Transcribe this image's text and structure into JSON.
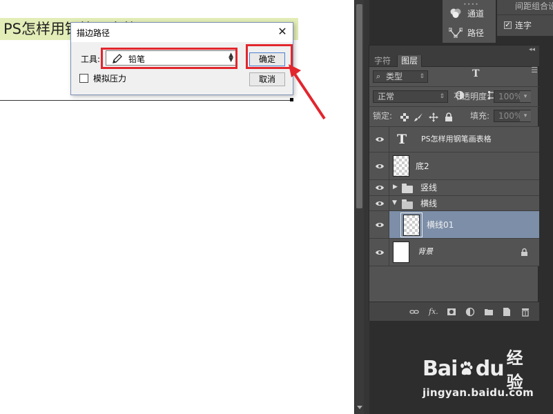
{
  "canvas": {
    "title_text": "PS怎样用钢笔画表格"
  },
  "dialog": {
    "title": "描边路径",
    "tool_label": "工具:",
    "tool_value": "铅笔",
    "ok_label": "确定",
    "cancel_label": "取消",
    "pressure_label": "模拟压力",
    "pressure_checked": false
  },
  "mini_panel": {
    "channels_label": "通道",
    "paths_label": "路径"
  },
  "para_panel": {
    "title": "间距组合设",
    "ligature_label": "连字",
    "ligature_checked": true
  },
  "layers_panel": {
    "tabs": [
      "字符",
      "图层"
    ],
    "active_tab": "图层",
    "filter_label": "类型",
    "blend_mode": "正常",
    "opacity_label": "不透明度:",
    "opacity_value": "100%",
    "lock_label": "锁定:",
    "fill_label": "填充:",
    "fill_value": "100%",
    "layers": [
      {
        "name": "PS怎样用钢笔画表格",
        "kind": "text"
      },
      {
        "name": "底2",
        "kind": "transparent"
      },
      {
        "name": "竖线",
        "kind": "group",
        "expanded": false
      },
      {
        "name": "横线",
        "kind": "group",
        "expanded": true
      },
      {
        "name": "横线01",
        "kind": "transparent",
        "selected": true
      },
      {
        "name": "背景",
        "kind": "background",
        "locked": true
      }
    ],
    "bottom_icons": [
      "link-icon",
      "fx-icon",
      "mask-icon",
      "adjustment-icon",
      "new-group-icon",
      "new-layer-icon",
      "trash-icon"
    ],
    "fx_text": "fx."
  },
  "watermark": {
    "brand_left": "Bai",
    "brand_right": "du",
    "brand_cn": "经验",
    "url": "jingyan.baidu.com"
  },
  "colors": {
    "highlight": "#e2262d",
    "title_band": "#e3edb7",
    "selected_layer": "#7c8ea8"
  }
}
